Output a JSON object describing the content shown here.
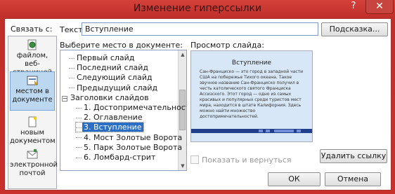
{
  "window": {
    "title": "Изменение гиперссылки",
    "help_glyph": "?",
    "close_glyph": "✕"
  },
  "link_with": {
    "label": "Связать с:",
    "items": [
      {
        "label": "файлом, веб-страницей",
        "icon": "globe-file-icon"
      },
      {
        "label": "местом в документе",
        "icon": "document-place-icon",
        "selected": true
      },
      {
        "label": "новым документом",
        "icon": "new-document-icon"
      },
      {
        "label": "электронной почтой",
        "icon": "email-icon"
      }
    ]
  },
  "text_field": {
    "label": "Текст:",
    "value": "Вступление"
  },
  "buttons": {
    "tip": "Подсказка...",
    "remove_link": "Удалить ссылку",
    "ok": "ОК",
    "cancel": "Отмена"
  },
  "place": {
    "label": "Выберите место в документе:",
    "tree": [
      {
        "text": "Первый слайд",
        "level": 1
      },
      {
        "text": "Последний слайд",
        "level": 1
      },
      {
        "text": "Следующий слайд",
        "level": 1
      },
      {
        "text": "Предыдущий слайд",
        "level": 1
      },
      {
        "text": "Заголовки слайдов",
        "level": 0,
        "expander": "−"
      },
      {
        "text": "1. Достопримечательности",
        "level": 2
      },
      {
        "text": "2. Оглавление",
        "level": 2
      },
      {
        "text": "3. Вступление",
        "level": 2,
        "selected": true
      },
      {
        "text": "4. Мост Золотые Ворота",
        "level": 2
      },
      {
        "text": "5. Парк Золотые Ворота",
        "level": 2
      },
      {
        "text": "6. Ломбард-стрит",
        "level": 2
      }
    ]
  },
  "preview": {
    "label": "Просмотр слайда:",
    "slide_title": "Вступление",
    "slide_text": "Сан-Франциско — это город в западной части США на побережье Тихого океана. Такое звучное название Сан-Франциско получил в честь католического святого Франциска Ассизского. Этот город — одно из самых красивых и популярных среди туристов мест мира, находится в штате Калифорния. Здесь можно найти множество достопримечательностей."
  },
  "show_and_return": {
    "label": "Показать и вернуться",
    "checked": false
  }
}
